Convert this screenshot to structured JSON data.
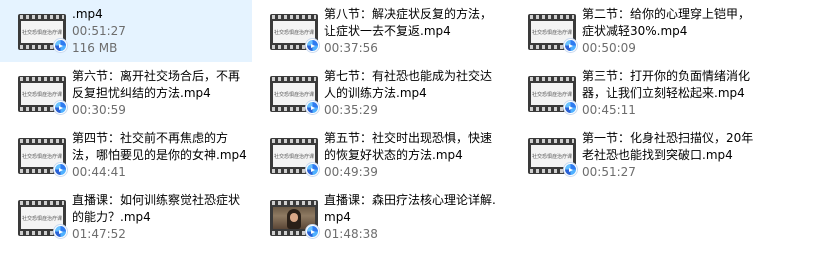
{
  "files": [
    {
      "name": ".mp4",
      "duration": "00:51:27",
      "size": "116 MB",
      "thumb": "text"
    },
    {
      "name": "第八节：解决症状反复的方法，让症状一去不复返.mp4",
      "duration": "00:37:56",
      "thumb": "text"
    },
    {
      "name": "第二节：给你的心理穿上铠甲，症状减轻30%.mp4",
      "duration": "00:50:09",
      "thumb": "text"
    },
    {
      "name": "第六节：离开社交场合后，不再反复担忧纠结的方法.mp4",
      "duration": "00:30:59",
      "thumb": "text"
    },
    {
      "name": "第七节：有社恐也能成为社交达人的训练方法.mp4",
      "duration": "00:35:29",
      "thumb": "text"
    },
    {
      "name": "第三节：打开你的负面情绪消化器，让我们立刻轻松起来.mp4",
      "duration": "00:45:11",
      "thumb": "text"
    },
    {
      "name": "第四节：社交前不再焦虑的方法，哪怕要见的是你的女神.mp4",
      "duration": "00:44:41",
      "thumb": "text"
    },
    {
      "name": "第五节：社交时出现恐惧，快速的恢复好状态的方法.mp4",
      "duration": "00:49:39",
      "thumb": "text"
    },
    {
      "name": "第一节：化身社恐扫描仪，20年老社恐也能找到突破口.mp4",
      "duration": "00:51:27",
      "thumb": "text"
    },
    {
      "name": "直播课：如何训练察觉社恐症状的能力？.mp4",
      "duration": "01:47:52",
      "thumb": "text"
    },
    {
      "name": "直播课：森田疗法核心理论详解.mp4",
      "duration": "01:48:38",
      "thumb": "photo"
    }
  ],
  "thumb_caption": "社交恐惧症治疗课",
  "colors": {
    "meta_text": "#6d6d6d",
    "hover": "#e5f3ff",
    "player_badge": "#2f7bf0"
  }
}
